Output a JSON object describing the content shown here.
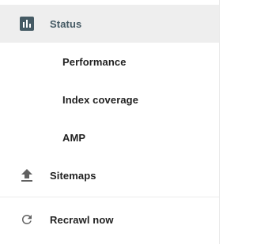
{
  "nav": {
    "items": [
      {
        "label": "Status",
        "icon": "bar-chart-icon",
        "active": true
      },
      {
        "label": "Performance"
      },
      {
        "label": "Index coverage"
      },
      {
        "label": "AMP"
      },
      {
        "label": "Sitemaps",
        "icon": "upload-icon"
      },
      {
        "label": "Recrawl now",
        "icon": "refresh-icon"
      }
    ]
  },
  "colors": {
    "active_bg": "#eeeeee",
    "active_text": "#455a64",
    "text": "#212121",
    "icon": "#616161"
  }
}
